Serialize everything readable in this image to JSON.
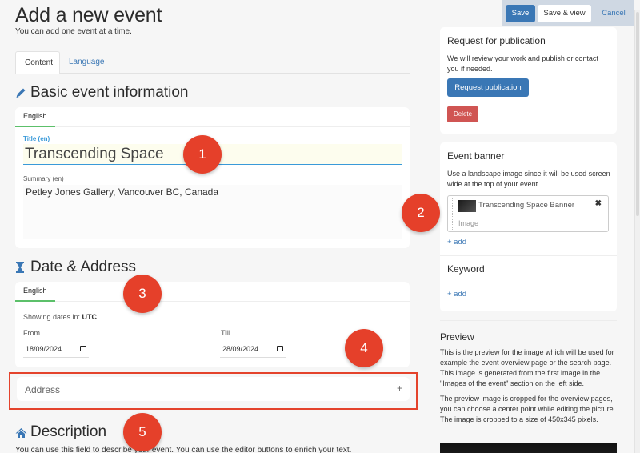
{
  "header": {
    "title": "Add a new event",
    "subtitle": "You can add one event at a time."
  },
  "tabs": [
    {
      "label": "Content",
      "active": true
    },
    {
      "label": "Language",
      "active": false
    }
  ],
  "basic_info": {
    "heading": "Basic event information",
    "icon": "pencil-icon",
    "lang_tab": "English",
    "title_label": "Title (en)",
    "title_value": "Transcending Space",
    "summary_label": "Summary (en)",
    "summary_value": "Petley Jones Gallery, Vancouver BC, Canada"
  },
  "date_address": {
    "heading": "Date & Address",
    "icon": "hourglass-icon",
    "lang_tab": "English",
    "timezone_prefix": "Showing dates in: ",
    "timezone": "UTC",
    "from_label": "From",
    "from_value": "18/09/2024",
    "till_label": "Till",
    "till_value": "28/09/2024",
    "address_label": "Address",
    "address_add": "+"
  },
  "description": {
    "heading": "Description",
    "icon": "home-icon",
    "text": "You can use this field to describe your event. You can use the editor buttons to enrich your text."
  },
  "toolbar": {
    "save": "Save",
    "save_view": "Save & view",
    "cancel": "Cancel"
  },
  "publication": {
    "title": "Request for publication",
    "text": "We will review your work and publish or contact you if needed.",
    "request_button": "Request publication",
    "delete_button": "Delete"
  },
  "banner": {
    "title": "Event banner",
    "text": "Use a landscape image since it will be used screen wide at the top of your event.",
    "item_name": "Transcending Space Banner",
    "item_type": "Image",
    "remove": "✖",
    "add": "+ add"
  },
  "keyword": {
    "title": "Keyword",
    "add": "+ add"
  },
  "preview": {
    "title": "Preview",
    "text1": "This is the preview for the image which will be used for example the event overview page or the search page. This image is generated from the first image in the \"Images of the event\" section on the left side.",
    "text2": "The preview image is cropped for the overview pages, you can choose a center point while editing the picture. The image is cropped to a size of 450x345 pixels."
  },
  "markers": [
    "1",
    "2",
    "3",
    "4",
    "5"
  ],
  "colors": {
    "accent": "#3a77b5",
    "danger": "#d05553",
    "marker": "#e5402a",
    "focus": "#3a9ad9",
    "lang_tab_underline": "#5cc06a"
  }
}
